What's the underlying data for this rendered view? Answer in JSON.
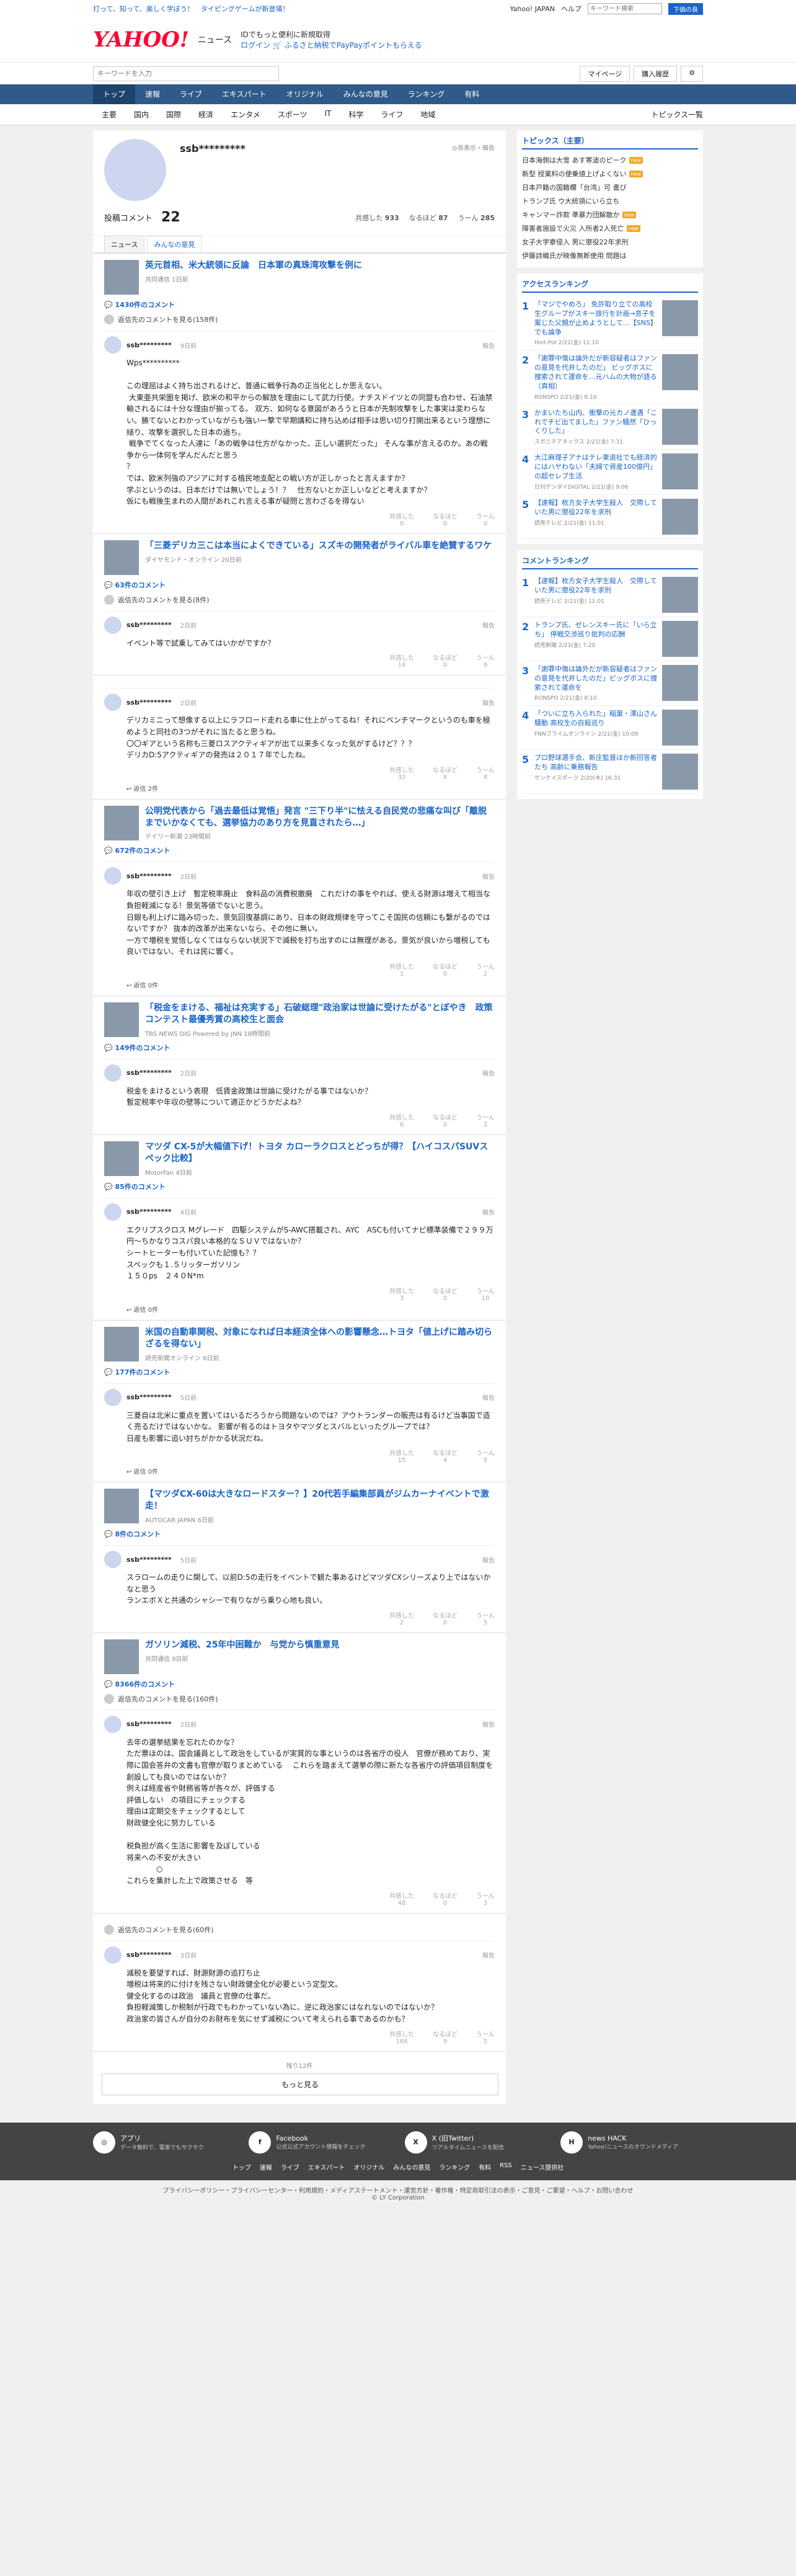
{
  "top": {
    "links": [
      "打って、知って、楽しく学ぼう！",
      "タイピングゲームが新登場！"
    ],
    "right": [
      "Yahoo! JAPAN",
      "ヘルプ"
    ],
    "search_placeholder": "キーワード検索",
    "search_btn": "ヘルプ",
    "search_btn2": "下価の良"
  },
  "header": {
    "logo": "YAHOO!",
    "logo_sub": "ニュース",
    "promo1": "IDでもっと便利に新規取得",
    "promo2": "ログイン 🛒 ふるさと納税でPayPayポイントもらえる"
  },
  "search": {
    "placeholder": "キーワードを入力",
    "mypage": "マイページ",
    "purchase": "購入履歴"
  },
  "gnav": [
    "トップ",
    "速報",
    "ライブ",
    "エキスパート",
    "オリジナル",
    "みんなの意見",
    "ランキング",
    "有料"
  ],
  "snav": [
    "主要",
    "国内",
    "国際",
    "経済",
    "エンタメ",
    "スポーツ",
    "IT",
    "科学",
    "ライフ",
    "地域"
  ],
  "snav_right": "トピックス一覧",
  "profile": {
    "name": "ssb*********",
    "report": "◎非表示・報告",
    "label": "投稿コメント",
    "count": "22",
    "r1l": "共感した",
    "r1": "933",
    "r2l": "なるほど",
    "r2": "87",
    "r3l": "うーん",
    "r3": "285"
  },
  "tabs": [
    "ニュース",
    "みんなの意見"
  ],
  "articles": [
    {
      "title": "英元首相、米大統領に反論　日本軍の真珠湾攻撃を例に",
      "src": "共同通信 1日前",
      "count": "1430件のコメント",
      "more": "返信先のコメントを見る(158件)",
      "user": "ssb*********",
      "time": "9日前",
      "body": "Wps**********\n\nこの理屈はよく持ち出されるけど、普通に戦争行為の正当化としか思えない。\n 大東亜共栄圏を掲げ、欧米の和平からの解放を理由にして武力行使。ナチスドイツとの同盟も合わせ、石油禁輸されるには十分な理由が揃ってる。 双方、如何なる意図があろうと日本が先制攻撃をした事実は変わらない。勝てないとわかっていながらも強い一撃で早期講和に持ち込めば相手は思い切り打開出来るという理想に縋り、攻撃を選択した日本の過ち。\n 戦争でてくなった人達に「あの戦争は仕方がなかった、正しい選択だった」 そんな事が言えるのか。あの戦争から一体何を学んだんだと思う\n？\nでは、欧米列強のアジアに対する植民地支配との戦い方が正しかったと言えますか？\n学ぶというのは、日本だけでは無いでしょう！？　仕方ないとか正しいなどと考えますか？\n仮にも戦後生まれの人間があれこれ言える事が疑問と言わざるを得ない",
      "a": "0",
      "b": "0",
      "c": "0",
      "reply": ""
    },
    {
      "title": "「三菱デリカ三こは本当によくできている」スズキの開発者がライバル車を絶賛するワケ",
      "src": "ダイヤモンド・オンライン 20日前",
      "count": "63件のコメント",
      "more": "返信先のコメントを見る(8件)",
      "user": "ssb*********",
      "time": "2日前",
      "body": "イベント等で試乗してみてはいかがですか？",
      "a": "14",
      "b": "0",
      "c": "9",
      "reply": ""
    },
    {
      "title": "",
      "src": "",
      "count": "",
      "more": "",
      "user": "ssb*********",
      "time": "2日前",
      "body": "デリカミニって想像する以上にラフロード走れる車に仕上がってるね！それにベンチマークというのも車を極めようと同社の3つがそれに当たると思うね。\n〇〇ギアという名称も三菱ロスアクティギアが出て以来多くなった気がするけど？？？\nデリカD:5アクティギアの発売は２０１７年でしたね。",
      "a": "32",
      "b": "8",
      "c": "8",
      "reply": "返信 2件"
    },
    {
      "title": "公明党代表から「過去最低は覚悟」発言 \"三下り半\"に怯える自民党の悲痛な叫び「離脱までいかなくても、選挙協力のあり方を見直されたら…」",
      "src": "デイリー新潮 23時間前",
      "count": "672件のコメント",
      "more": "",
      "user": "ssb*********",
      "time": "2日前",
      "body": "年収の壁引き上げ　暫定税率廃止　食料品の消費税撤廃　これだけの事をやれば、使える財源は増えて相当な負担軽減になる！景気等値でないと思う。\n日銀も利上げに踏み切った、景気回復基調にあり、日本の財政規律を守ってこそ国民の信頼にも繋がるのではないですか？ 抜本的改革が出来ないなら、その他に無い。\n一方で増税を覚悟しなくてはならない状況下で減税を打ち出すのには無理がある。景気が良いから増税しても良いではない、それは民に響く。",
      "a": "1",
      "b": "0",
      "c": "2",
      "reply": "返信 0件"
    },
    {
      "title": "「税金をまける、福祉は充実する」石破総理\"政治家は世論に受けたがる\"とぼやき　政策コンテスト最優秀賞の高校生と面会",
      "src": "TBS NEWS DIG Powered by JNN 18時間前",
      "count": "149件のコメント",
      "more": "",
      "user": "ssb*********",
      "time": "2日前",
      "body": "税金をまけるという表現　低賃金政策は世論に受けたがる事ではないか？\n暫定税率や年収の壁等について適正かどうかだよね？",
      "a": "6",
      "b": "0",
      "c": "2",
      "reply": ""
    },
    {
      "title": "マツダ CX-5が大幅値下げ！トヨタ カローラクロスとどっちが得？【ハイコスパSUVスペック比較】",
      "src": "MotorFan 4日前",
      "count": "85件のコメント",
      "more": "",
      "user": "ssb*********",
      "time": "4日前",
      "body": "エクリプスクロス Mグレード　四駆システムがS-AWC搭載され、AYC　ASCも付いてナビ標準装備で２９９万円～ちかなりコスパ良い本格的なＳＵＶではないか？\nシートヒーターも付いていた記憶も？？\nスペックも１.５リッターガソリン\n１５０ps　２４０N*m",
      "a": "3",
      "b": "0",
      "c": "10",
      "reply": "返信 0件"
    },
    {
      "title": "米国の自動車関税、対象になれば日本経済全体への影響懸念…トヨタ「値上げに踏み切らざるを得ない」",
      "src": "読売新聞オンライン 6日前",
      "count": "177件のコメント",
      "more": "",
      "user": "ssb*********",
      "time": "5日前",
      "body": "三菱自は北米に重点を置いてはいるだろうから問題ないのでは？アウトランダーの販売は有るけど当事国で造く売るだけではないかな。 影響が有るのはトヨタやマツダとスバルといったグループでは？\n日産も影響に追い討ちがかかる状況だね。",
      "a": "15",
      "b": "4",
      "c": "5",
      "reply": "返信 0件"
    },
    {
      "title": "【マツダCX-60は大きなロードスター？】20代若手編集部員がジムカーナイベントで激走！",
      "src": "AUTOCAR JAPAN 6日前",
      "count": "8件のコメント",
      "more": "",
      "user": "ssb*********",
      "time": "5日前",
      "body": "スラロームの走りに関して、以前D:5の走行をイベントで観た事あるけどマツダCXシリーズより上ではないかなと思う\nランエボＸと共通のシャシーで有りながら乗り心地も良い。",
      "a": "2",
      "b": "0",
      "c": "5",
      "reply": ""
    },
    {
      "title": "ガソリン減税、25年中困難か　与党から慎重意見",
      "src": "共同通信 9日前",
      "count": "8366件のコメント",
      "more": "返信先のコメントを見る(160件)",
      "user": "ssb*********",
      "time": "2日前",
      "body": "去年の選挙結果を忘れたのかな？\nただ票ほのは、国会議員として政治をしているが実質的な事というのは各省庁の役人　官僚が務めており、実際に国会答弁の文書も官僚が取りまとめている　 これらを踏まえて選挙の際に新たな各省庁の評価項目制度を創設しても良いのではないか？\n例えば経産省や財務省等が各々が、評価する\n評価しない　の項目にチェックする\n理由は定期交をチェックするとして\n財政健全化に努力している\n\n税負担が高く生活に影響を及ぼしている\n将来への不安が大きい\n　　　　○\nこれらを集計した上で政策させる　等",
      "a": "48",
      "b": "0",
      "c": "3",
      "reply": ""
    },
    {
      "title": "",
      "src": "",
      "count": "",
      "more": "返信先のコメントを見る(60件)",
      "user": "ssb*********",
      "time": "3日前",
      "body": "減税を要望すれば、財源財源の追打ち止\n増税は将来的に付けを残さない財政健全化が必要という定型文。\n健全化するのは政治　議員と官僚の仕事だ。\n負担軽減策しか税制が行政でもわかっていない為に、逆に政治家にはなれないのではないか？\n政治家の皆さんが自分のお財布を気にせず減税について考えられる事であるのかも？",
      "a": "168",
      "b": "9",
      "c": "5",
      "reply": ""
    }
  ],
  "loadmore": {
    "remain": "残り12件",
    "btn": "もっと見る"
  },
  "react_labels": [
    "共感した",
    "なるほど",
    "うーん"
  ],
  "topics": {
    "title": "トピックス（主要）",
    "items": [
      "日本海側は大雪 あす寒波のピーク",
      "新型 授業料の便乗値上げよくない",
      "日本戸籍の国籍欄「台湾」可 書び",
      "トランプ氏 ウ大統領にいら立ち",
      "キャンマー詐欺 準暴力団解散か",
      "障害者施設で火災 入所者2人死亡",
      "女子大学寮侵入 男に懲役22年求刑",
      "伊藤詩織氏が映像無断使用 問題は"
    ]
  },
  "access": {
    "title": "アクセスランキング",
    "items": [
      {
        "t": "「マジでやめろ」 免許取り立ての高校生グループがスキー旅行を計画→息子を案じた父親が止めようとして…【SNS】でも論争",
        "s": "Hint-Pot 2/21(金) 11:10"
      },
      {
        "t": "「謝罪中傷は論外だが新容疑者はファンの意見を代弁したのだ」 ビッグボスに捜索されて運命を…元ハムの大物が語る（真相）",
        "s": "RONSPO 2/21(金) 8:10"
      },
      {
        "t": "かまいたち山内、衝撃の元カノ遭遇「これでチビ出てました」ファン騒然「ひっくりした」",
        "s": "スポニチアネックス 2/21(金) 7:31"
      },
      {
        "t": "大江麻理子アナはテレ東退社でも経済的にはハヤわない「夫婦で資産100億円」の超セレブ生活",
        "s": "日刊ゲンダイDIGITAL 2/21(金) 9:06"
      },
      {
        "t": "【速報】枚方女子大学生殺人　交際していた男に懲役22年を求刑",
        "s": "読売テレビ 2/21(金) 11:01"
      }
    ]
  },
  "comrank": {
    "title": "コメントランキング",
    "items": [
      {
        "t": "【速報】枚方女子大学生殺人　交際していた男に懲役22年を求刑",
        "s": "読売テレビ 2/21(金) 11:01"
      },
      {
        "t": "トランプ氏、ゼレンスキー氏に「いら立ち」 停戦交渉巡り批判の応酬",
        "s": "読売新聞 2/21(金) 7:20"
      },
      {
        "t": "「謝罪中傷は論外だが新容疑者はファンの意見を代弁したのだ」ビッグボスに捜索されて運命を",
        "s": "RONSPO 2/21(金) 8:10"
      },
      {
        "t": "「ついに立ち入られた」稲葉・澤山さん騒動 高校生の自殺巡り",
        "s": "FNNプライムオンライン 2/21(金) 10:09"
      },
      {
        "t": "プロ野球選手会、新庄監督ほか新回答者たち 高齢に乗務報告",
        "s": "サンケイスポーツ 2/20(木) 16:31"
      }
    ]
  },
  "footer": {
    "cols": [
      {
        "icon": "◎",
        "title": "アプリ",
        "sub": "データ無料で、電車でもサクサク"
      },
      {
        "icon": "f",
        "title": "Facebook",
        "sub": "公式公式アカウント情報をチェック"
      },
      {
        "icon": "X",
        "title": "X (旧Twitter)",
        "sub": "リアルタイムニュースを配信"
      },
      {
        "icon": "H",
        "title": "news HACK",
        "sub": "Yahoo!ニュースのオウンドメディア"
      }
    ],
    "nav": [
      "トップ",
      "速報",
      "ライブ",
      "エキスパート",
      "オリジナル",
      "みんなの意見",
      "ランキング",
      "有料",
      "RSS",
      "ニュース提供社"
    ],
    "bottom": "プライバシーポリシー・プライバシーセンター・利用規約・メディアステートメント・運営方針・著作権・特定商取引法の表示・ご意見・ご要望・ヘルプ・お問い合わせ",
    "copy": "© LY Corporation"
  }
}
